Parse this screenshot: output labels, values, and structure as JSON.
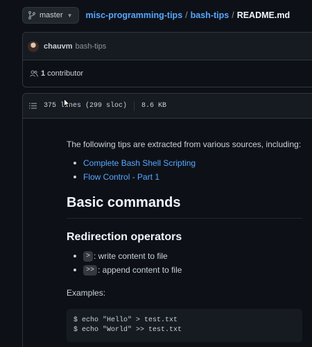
{
  "branch": {
    "label": "master"
  },
  "breadcrumb": {
    "repo": "misc-programming-tips",
    "folder": "bash-tips",
    "file": "README.md",
    "separator": "/"
  },
  "commit": {
    "author": "chauvm",
    "repo": "bash-tips"
  },
  "contributors": {
    "count": "1",
    "label": "contributor"
  },
  "file_info": {
    "lines": "375 lines (299 sloc)",
    "size": "8.6 KB"
  },
  "readme": {
    "intro": "The following tips are extracted from various sources, including:",
    "sources": [
      {
        "label": "Complete Bash Shell Scripting"
      },
      {
        "label": "Flow Control - Part 1"
      }
    ],
    "h1": "Basic commands",
    "h2": "Redirection operators",
    "operators": [
      {
        "code": ">",
        "desc": ": write content to file"
      },
      {
        "code": ">>",
        "desc": ": append content to file"
      }
    ],
    "examples_label": "Examples:",
    "code_lines": [
      "$ echo \"Hello\" > test.txt",
      "$ echo \"World\" >> test.txt"
    ]
  },
  "colors": {
    "link": "#58a6ff",
    "bg": "#0d1117",
    "panel": "#161b22",
    "border": "#30363d"
  }
}
